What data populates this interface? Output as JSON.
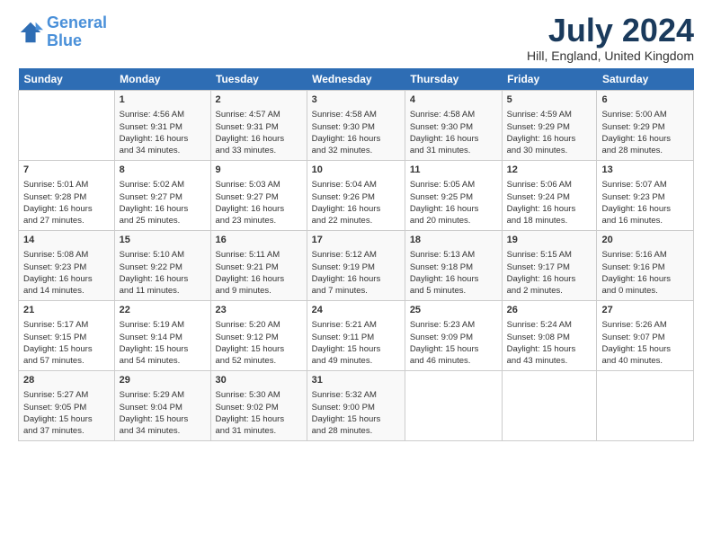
{
  "logo": {
    "line1": "General",
    "line2": "Blue"
  },
  "title": "July 2024",
  "location": "Hill, England, United Kingdom",
  "days_header": [
    "Sunday",
    "Monday",
    "Tuesday",
    "Wednesday",
    "Thursday",
    "Friday",
    "Saturday"
  ],
  "weeks": [
    [
      {
        "day": "",
        "info": ""
      },
      {
        "day": "1",
        "info": "Sunrise: 4:56 AM\nSunset: 9:31 PM\nDaylight: 16 hours\nand 34 minutes."
      },
      {
        "day": "2",
        "info": "Sunrise: 4:57 AM\nSunset: 9:31 PM\nDaylight: 16 hours\nand 33 minutes."
      },
      {
        "day": "3",
        "info": "Sunrise: 4:58 AM\nSunset: 9:30 PM\nDaylight: 16 hours\nand 32 minutes."
      },
      {
        "day": "4",
        "info": "Sunrise: 4:58 AM\nSunset: 9:30 PM\nDaylight: 16 hours\nand 31 minutes."
      },
      {
        "day": "5",
        "info": "Sunrise: 4:59 AM\nSunset: 9:29 PM\nDaylight: 16 hours\nand 30 minutes."
      },
      {
        "day": "6",
        "info": "Sunrise: 5:00 AM\nSunset: 9:29 PM\nDaylight: 16 hours\nand 28 minutes."
      }
    ],
    [
      {
        "day": "7",
        "info": "Sunrise: 5:01 AM\nSunset: 9:28 PM\nDaylight: 16 hours\nand 27 minutes."
      },
      {
        "day": "8",
        "info": "Sunrise: 5:02 AM\nSunset: 9:27 PM\nDaylight: 16 hours\nand 25 minutes."
      },
      {
        "day": "9",
        "info": "Sunrise: 5:03 AM\nSunset: 9:27 PM\nDaylight: 16 hours\nand 23 minutes."
      },
      {
        "day": "10",
        "info": "Sunrise: 5:04 AM\nSunset: 9:26 PM\nDaylight: 16 hours\nand 22 minutes."
      },
      {
        "day": "11",
        "info": "Sunrise: 5:05 AM\nSunset: 9:25 PM\nDaylight: 16 hours\nand 20 minutes."
      },
      {
        "day": "12",
        "info": "Sunrise: 5:06 AM\nSunset: 9:24 PM\nDaylight: 16 hours\nand 18 minutes."
      },
      {
        "day": "13",
        "info": "Sunrise: 5:07 AM\nSunset: 9:23 PM\nDaylight: 16 hours\nand 16 minutes."
      }
    ],
    [
      {
        "day": "14",
        "info": "Sunrise: 5:08 AM\nSunset: 9:23 PM\nDaylight: 16 hours\nand 14 minutes."
      },
      {
        "day": "15",
        "info": "Sunrise: 5:10 AM\nSunset: 9:22 PM\nDaylight: 16 hours\nand 11 minutes."
      },
      {
        "day": "16",
        "info": "Sunrise: 5:11 AM\nSunset: 9:21 PM\nDaylight: 16 hours\nand 9 minutes."
      },
      {
        "day": "17",
        "info": "Sunrise: 5:12 AM\nSunset: 9:19 PM\nDaylight: 16 hours\nand 7 minutes."
      },
      {
        "day": "18",
        "info": "Sunrise: 5:13 AM\nSunset: 9:18 PM\nDaylight: 16 hours\nand 5 minutes."
      },
      {
        "day": "19",
        "info": "Sunrise: 5:15 AM\nSunset: 9:17 PM\nDaylight: 16 hours\nand 2 minutes."
      },
      {
        "day": "20",
        "info": "Sunrise: 5:16 AM\nSunset: 9:16 PM\nDaylight: 16 hours\nand 0 minutes."
      }
    ],
    [
      {
        "day": "21",
        "info": "Sunrise: 5:17 AM\nSunset: 9:15 PM\nDaylight: 15 hours\nand 57 minutes."
      },
      {
        "day": "22",
        "info": "Sunrise: 5:19 AM\nSunset: 9:14 PM\nDaylight: 15 hours\nand 54 minutes."
      },
      {
        "day": "23",
        "info": "Sunrise: 5:20 AM\nSunset: 9:12 PM\nDaylight: 15 hours\nand 52 minutes."
      },
      {
        "day": "24",
        "info": "Sunrise: 5:21 AM\nSunset: 9:11 PM\nDaylight: 15 hours\nand 49 minutes."
      },
      {
        "day": "25",
        "info": "Sunrise: 5:23 AM\nSunset: 9:09 PM\nDaylight: 15 hours\nand 46 minutes."
      },
      {
        "day": "26",
        "info": "Sunrise: 5:24 AM\nSunset: 9:08 PM\nDaylight: 15 hours\nand 43 minutes."
      },
      {
        "day": "27",
        "info": "Sunrise: 5:26 AM\nSunset: 9:07 PM\nDaylight: 15 hours\nand 40 minutes."
      }
    ],
    [
      {
        "day": "28",
        "info": "Sunrise: 5:27 AM\nSunset: 9:05 PM\nDaylight: 15 hours\nand 37 minutes."
      },
      {
        "day": "29",
        "info": "Sunrise: 5:29 AM\nSunset: 9:04 PM\nDaylight: 15 hours\nand 34 minutes."
      },
      {
        "day": "30",
        "info": "Sunrise: 5:30 AM\nSunset: 9:02 PM\nDaylight: 15 hours\nand 31 minutes."
      },
      {
        "day": "31",
        "info": "Sunrise: 5:32 AM\nSunset: 9:00 PM\nDaylight: 15 hours\nand 28 minutes."
      },
      {
        "day": "",
        "info": ""
      },
      {
        "day": "",
        "info": ""
      },
      {
        "day": "",
        "info": ""
      }
    ]
  ]
}
